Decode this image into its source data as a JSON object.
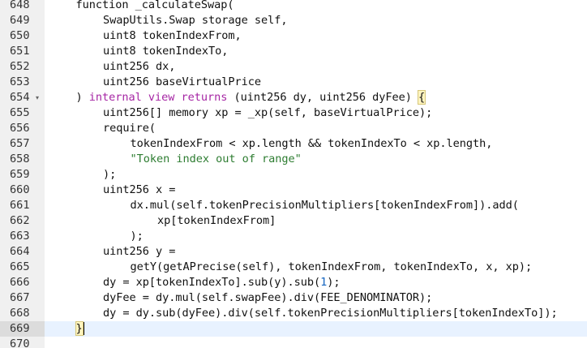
{
  "editor": {
    "lines": [
      {
        "n": "648",
        "fold": "",
        "indent": 1,
        "parts": [
          {
            "t": "function _calculateSwap("
          }
        ]
      },
      {
        "n": "649",
        "fold": "",
        "indent": 2,
        "parts": [
          {
            "t": "SwapUtils.Swap storage self,"
          }
        ]
      },
      {
        "n": "650",
        "fold": "",
        "indent": 2,
        "parts": [
          {
            "t": "uint8 tokenIndexFrom,"
          }
        ]
      },
      {
        "n": "651",
        "fold": "",
        "indent": 2,
        "parts": [
          {
            "t": "uint8 tokenIndexTo,"
          }
        ]
      },
      {
        "n": "652",
        "fold": "",
        "indent": 2,
        "parts": [
          {
            "t": "uint256 dx,"
          }
        ]
      },
      {
        "n": "653",
        "fold": "",
        "indent": 2,
        "parts": [
          {
            "t": "uint256 baseVirtualPrice"
          }
        ]
      },
      {
        "n": "654",
        "fold": "▾",
        "indent": 1,
        "parts": [
          {
            "t": ") "
          },
          {
            "t": "internal",
            "c": "kw"
          },
          {
            "t": " "
          },
          {
            "t": "view",
            "c": "kw"
          },
          {
            "t": " "
          },
          {
            "t": "returns",
            "c": "kw"
          },
          {
            "t": " (uint256 dy, uint256 dyFee) "
          },
          {
            "t": "{",
            "c": "hl"
          }
        ]
      },
      {
        "n": "655",
        "fold": "",
        "indent": 2,
        "parts": [
          {
            "t": "uint256[] memory xp = _xp(self, baseVirtualPrice);"
          }
        ]
      },
      {
        "n": "656",
        "fold": "",
        "indent": 2,
        "parts": [
          {
            "t": "require("
          }
        ]
      },
      {
        "n": "657",
        "fold": "",
        "indent": 3,
        "parts": [
          {
            "t": "tokenIndexFrom < xp.length && tokenIndexTo < xp.length,"
          }
        ]
      },
      {
        "n": "658",
        "fold": "",
        "indent": 3,
        "parts": [
          {
            "t": "\"Token index out of range\"",
            "c": "str"
          }
        ]
      },
      {
        "n": "659",
        "fold": "",
        "indent": 2,
        "parts": [
          {
            "t": ");"
          }
        ]
      },
      {
        "n": "660",
        "fold": "",
        "indent": 2,
        "parts": [
          {
            "t": "uint256 x ="
          }
        ]
      },
      {
        "n": "661",
        "fold": "",
        "indent": 3,
        "parts": [
          {
            "t": "dx.mul(self.tokenPrecisionMultipliers[tokenIndexFrom]).add("
          }
        ]
      },
      {
        "n": "662",
        "fold": "",
        "indent": 4,
        "parts": [
          {
            "t": "xp[tokenIndexFrom]"
          }
        ]
      },
      {
        "n": "663",
        "fold": "",
        "indent": 3,
        "parts": [
          {
            "t": ");"
          }
        ]
      },
      {
        "n": "664",
        "fold": "",
        "indent": 2,
        "parts": [
          {
            "t": "uint256 y ="
          }
        ]
      },
      {
        "n": "665",
        "fold": "",
        "indent": 3,
        "parts": [
          {
            "t": "getY(getAPrecise(self), tokenIndexFrom, tokenIndexTo, x, xp);"
          }
        ]
      },
      {
        "n": "666",
        "fold": "",
        "indent": 2,
        "parts": [
          {
            "t": "dy = xp[tokenIndexTo].sub(y).sub("
          },
          {
            "t": "1",
            "c": "num"
          },
          {
            "t": ");"
          }
        ]
      },
      {
        "n": "667",
        "fold": "",
        "indent": 2,
        "parts": [
          {
            "t": "dyFee = dy.mul(self.swapFee).div(FEE_DENOMINATOR);"
          }
        ]
      },
      {
        "n": "668",
        "fold": "",
        "indent": 2,
        "parts": [
          {
            "t": "dy = dy.sub(dyFee).div(self.tokenPrecisionMultipliers[tokenIndexTo]);"
          }
        ]
      },
      {
        "n": "669",
        "fold": "",
        "indent": 1,
        "active": true,
        "cursor": true,
        "parts": [
          {
            "t": "}",
            "c": "hl"
          }
        ]
      },
      {
        "n": "670",
        "fold": "",
        "indent": 0,
        "parts": []
      }
    ]
  }
}
